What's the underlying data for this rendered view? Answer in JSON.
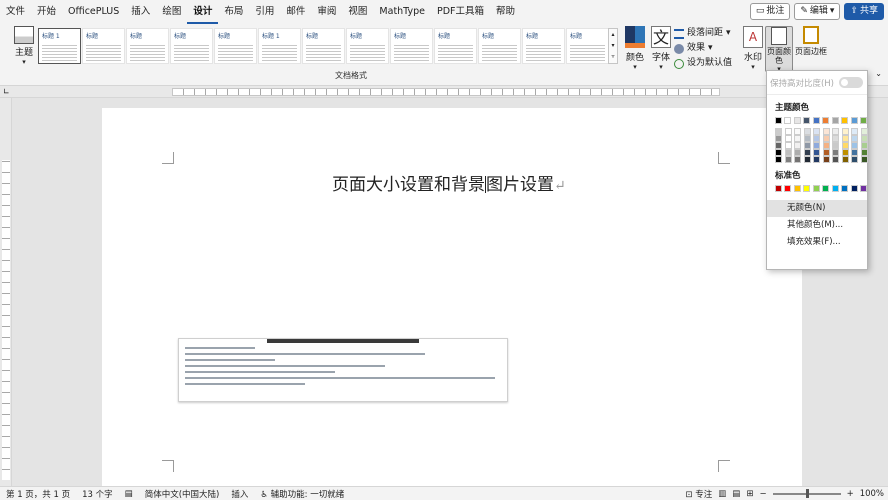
{
  "menu": {
    "items": [
      "文件",
      "开始",
      "OfficePLUS",
      "插入",
      "绘图",
      "设计",
      "布局",
      "引用",
      "邮件",
      "审阅",
      "视图",
      "MathType",
      "PDF工具箱",
      "帮助"
    ],
    "active_index": 5,
    "comments_label": "批注",
    "edit_label": "编辑",
    "share_label": "共享"
  },
  "ribbon": {
    "theme_label": "主题",
    "style_thumbs": [
      "标题 1",
      "标题",
      "标题",
      "标题",
      "标题",
      "标题 1",
      "标题",
      "标题",
      "标题",
      "标题",
      "标题",
      "标题",
      "标题"
    ],
    "group_label": "文档格式",
    "colors_label": "颜色",
    "fonts_label": "字体",
    "paragraph_spacing_label": "段落间距",
    "effects_label": "效果",
    "set_default_label": "设为默认值",
    "watermark_label": "水印",
    "page_color_label": "页面颜色",
    "page_borders_label": "页面边框"
  },
  "document": {
    "title": "页面大小设置和背景图片设置",
    "title_before_cursor": "页面大小设置和背景",
    "title_after_cursor": "图片设置"
  },
  "dropdown": {
    "preserve_label": "保持高对比度(H)",
    "theme_colors_label": "主题颜色",
    "standard_colors_label": "标准色",
    "no_color_label": "无颜色(N)",
    "more_colors_label": "其他颜色(M)...",
    "fill_effects_label": "填充效果(F)...",
    "theme_row": [
      "#000000",
      "#ffffff",
      "#e7e6e6",
      "#44546a",
      "#4472c4",
      "#ed7d31",
      "#a5a5a5",
      "#ffc000",
      "#5b9bd5",
      "#70ad47"
    ],
    "standard_row": [
      "#c00000",
      "#ff0000",
      "#ffc000",
      "#ffff00",
      "#92d050",
      "#00b050",
      "#00b0f0",
      "#0070c0",
      "#002060",
      "#7030a0"
    ]
  },
  "status": {
    "page": "第 1 页，共 1 页",
    "words": "13 个字",
    "language": "简体中文(中国大陆)",
    "insert_mode": "插入",
    "accessibility": "辅助功能: 一切就绪",
    "focus": "专注",
    "zoom": "100%"
  }
}
